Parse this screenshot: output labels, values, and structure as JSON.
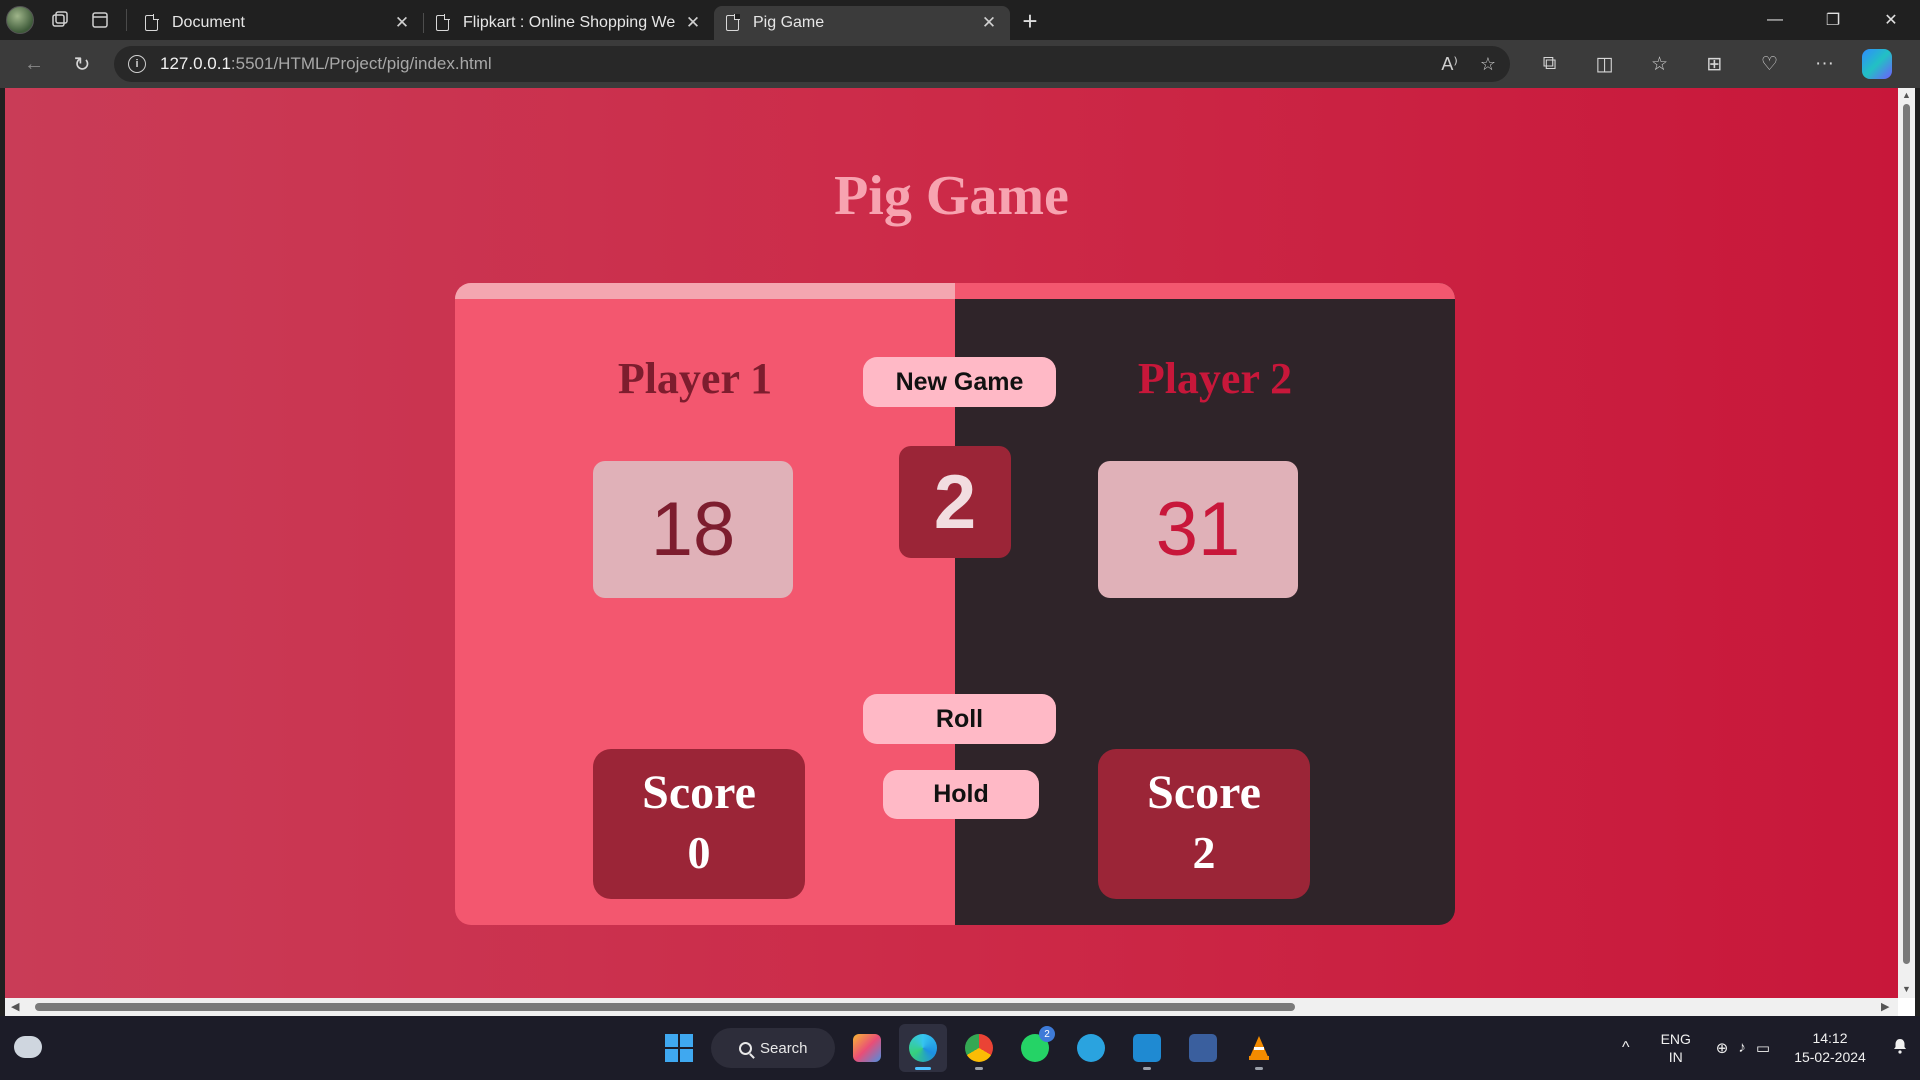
{
  "browser": {
    "tabs": [
      {
        "title": "Document",
        "active": false
      },
      {
        "title": "Flipkart : Online Shopping Websi",
        "active": false
      },
      {
        "title": "Pig Game",
        "active": true
      }
    ],
    "url": {
      "host": "127.0.0.1",
      "path": ":5501/HTML/Project/pig/index.html"
    },
    "icons": {
      "back": "←",
      "refresh": "↻",
      "read_aloud": "A⁾",
      "favorite": "☆",
      "extensions": "⧉",
      "split": "◫",
      "favorites": "☆",
      "collections": "⊞",
      "health": "♡",
      "more": "···",
      "minimize": "—",
      "restore": "❐",
      "close": "✕",
      "new_tab": "+"
    }
  },
  "game": {
    "title": "Pig Game",
    "new_game": "New Game",
    "roll": "Roll",
    "hold": "Hold",
    "dice": "2",
    "players": [
      {
        "name": "Player 1",
        "current": "18",
        "score_label": "Score",
        "score": "0"
      },
      {
        "name": "Player 2",
        "current": "31",
        "score_label": "Score",
        "score": "2"
      }
    ]
  },
  "taskbar": {
    "search": "Search",
    "whatsapp_badge": "2",
    "lang_line1": "ENG",
    "lang_line2": "IN",
    "time": "14:12",
    "date": "15-02-2024",
    "icons": {
      "chevron": "^",
      "network": "⊕",
      "volume": "♪",
      "battery": "▭",
      "bell": "🔔"
    }
  },
  "colors": {
    "page_left": "#c93c57",
    "page_right": "#c8173a",
    "player1_panel": "#f3576f",
    "player2_panel": "#2f2429",
    "button": "#ffb9c6",
    "dice": "#9b2537",
    "title": "#f7a3b0"
  }
}
